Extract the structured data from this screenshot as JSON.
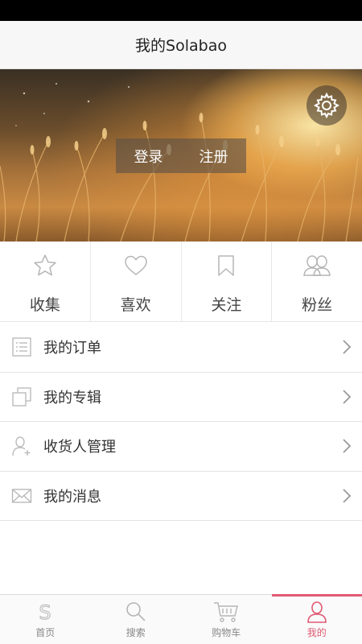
{
  "header": {
    "title": "我的Solabao"
  },
  "banner": {
    "login_label": "登录",
    "register_label": "注册"
  },
  "stats": [
    {
      "label": "收集",
      "icon": "star-icon"
    },
    {
      "label": "喜欢",
      "icon": "heart-icon"
    },
    {
      "label": "关注",
      "icon": "bookmark-icon"
    },
    {
      "label": "粉丝",
      "icon": "fans-icon"
    }
  ],
  "menu": [
    {
      "label": "我的订单",
      "icon": "order-list-icon"
    },
    {
      "label": "我的专辑",
      "icon": "album-icon"
    },
    {
      "label": "收货人管理",
      "icon": "add-person-icon"
    },
    {
      "label": "我的消息",
      "icon": "mail-icon"
    }
  ],
  "tabs": [
    {
      "label": "首页",
      "icon": "home-s-icon",
      "active": false
    },
    {
      "label": "搜索",
      "icon": "search-icon",
      "active": false
    },
    {
      "label": "购物车",
      "icon": "cart-icon",
      "active": false
    },
    {
      "label": "我的",
      "icon": "person-icon",
      "active": true
    }
  ],
  "colors": {
    "accent": "#e05a73",
    "icon_gray": "#b5b5b5"
  }
}
